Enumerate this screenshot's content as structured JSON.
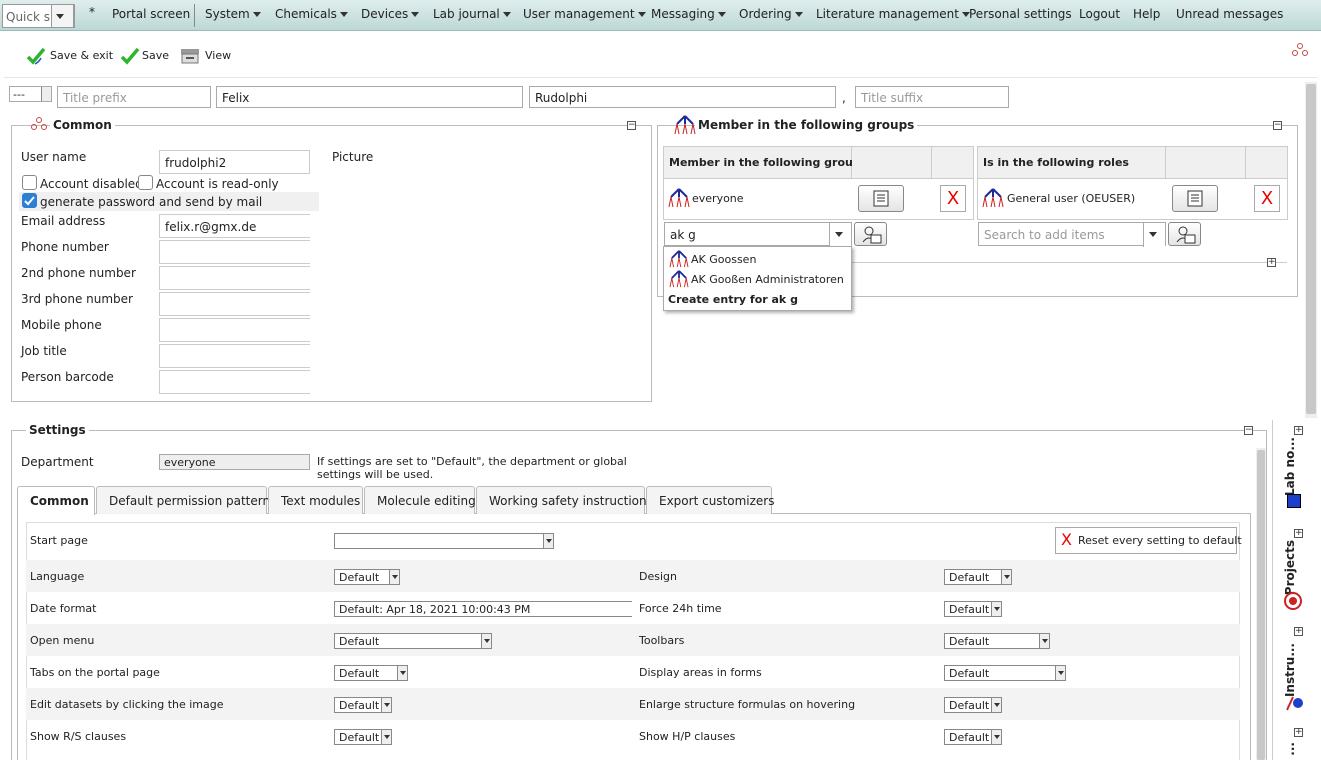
{
  "menu": {
    "quick_search": "Quick s",
    "star": "*",
    "items": [
      "Portal screen",
      "System",
      "Chemicals",
      "Devices",
      "Lab journal",
      "User management",
      "Messaging",
      "Ordering",
      "Literature management",
      "Personal settings",
      "Logout",
      "Help",
      "Unread messages"
    ]
  },
  "toolbar": {
    "save_exit": "Save & exit",
    "save": "Save",
    "view": "View"
  },
  "name_row": {
    "salutation": "---",
    "title_prefix_ph": "Title prefix",
    "first_name": "Felix",
    "last_name": "Rudolphi",
    "comma": ",",
    "title_suffix_ph": "Title suffix"
  },
  "common": {
    "legend": "Common",
    "picture_label": "Picture",
    "username_label": "User name",
    "username": "frudolphi2",
    "account_disabled": "Account disabled",
    "account_readonly": "Account is read-only",
    "gen_password": "generate password and send by mail",
    "email_label": "Email address",
    "email": "felix.r@gmx.de",
    "phone_label": "Phone number",
    "phone2_label": "2nd phone number",
    "phone3_label": "3rd phone number",
    "mobile_label": "Mobile phone",
    "job_label": "Job title",
    "barcode_label": "Person barcode"
  },
  "groups": {
    "legend": "Member in the following groups",
    "col_groups": "Member in the following groups",
    "group_item": "everyone",
    "col_roles": "Is in the following roles",
    "role_item": "General user (OEUSER)",
    "group_search": "ak g",
    "role_search_ph": "Search to add items",
    "dropdown": [
      "AK Goossen",
      "AK Gooßen Administratoren"
    ],
    "create_entry": "Create entry for ak g"
  },
  "settings": {
    "legend": "Settings",
    "dept_label": "Department",
    "dept_value": "everyone",
    "dept_note": "If settings are set to \"Default\", the department or global settings will be used.",
    "tabs": [
      "Common",
      "Default permission patterns",
      "Text modules",
      "Molecule editing",
      "Working safety instructions",
      "Export customizers"
    ],
    "reset": "Reset every setting to default",
    "start_page": "Start page",
    "rows": [
      {
        "l": "Language",
        "lv": "Default",
        "r": "Design",
        "rv": "Default"
      },
      {
        "l": "Date format",
        "lv": "Default: Apr 18, 2021 10:00:43 PM",
        "r": "Force 24h time",
        "rv": "Default"
      },
      {
        "l": "Open menu",
        "lv": "Default",
        "r": "Toolbars",
        "rv": "Default"
      },
      {
        "l": "Tabs on the portal page",
        "lv": "Default",
        "r": "Display areas in forms",
        "rv": "Default"
      },
      {
        "l": "Edit datasets by clicking the image",
        "lv": "Default",
        "r": "Enlarge structure formulas on hovering",
        "rv": "Default"
      },
      {
        "l": "Show R/S clauses",
        "lv": "Default",
        "r": "Show H/P clauses",
        "rv": "Default"
      }
    ]
  },
  "side_tabs": [
    "Lab no...",
    "Projects",
    "Instru...",
    "..."
  ],
  "colors": {
    "menu_bg": "#c8e0de",
    "accent_blue": "#2b7fd6",
    "x_red": "#e00000",
    "check_green": "#2db52d"
  }
}
